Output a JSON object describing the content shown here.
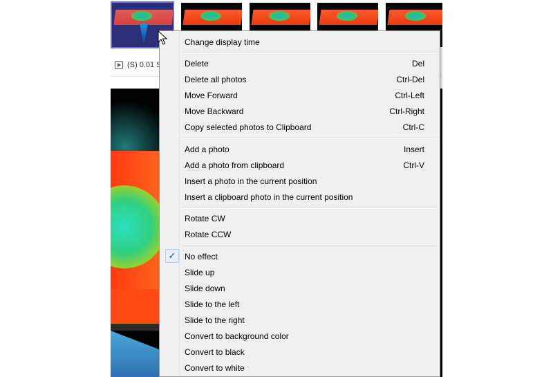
{
  "status": {
    "duration_text": "(S) 0.01 S"
  },
  "menu": {
    "items": [
      {
        "label": "Change display time",
        "shortcut": ""
      },
      {
        "label": "Delete",
        "shortcut": "Del"
      },
      {
        "label": "Delete all photos",
        "shortcut": "Ctrl-Del"
      },
      {
        "label": "Move Forward",
        "shortcut": "Ctrl-Left"
      },
      {
        "label": "Move Backward",
        "shortcut": "Ctrl-Right"
      },
      {
        "label": "Copy selected photos to Clipboard",
        "shortcut": "Ctrl-C"
      },
      {
        "label": "Add a photo",
        "shortcut": "Insert"
      },
      {
        "label": "Add a photo from clipboard",
        "shortcut": "Ctrl-V"
      },
      {
        "label": "Insert a photo in the current position",
        "shortcut": ""
      },
      {
        "label": "Insert a clipboard photo in the current position",
        "shortcut": ""
      },
      {
        "label": "Rotate CW",
        "shortcut": ""
      },
      {
        "label": "Rotate CCW",
        "shortcut": ""
      },
      {
        "label": "No effect",
        "shortcut": "",
        "checked": true
      },
      {
        "label": "Slide up",
        "shortcut": ""
      },
      {
        "label": "Slide down",
        "shortcut": ""
      },
      {
        "label": "Slide to the left",
        "shortcut": ""
      },
      {
        "label": "Slide to the right",
        "shortcut": ""
      },
      {
        "label": "Convert to background color",
        "shortcut": ""
      },
      {
        "label": "Convert to black",
        "shortcut": ""
      },
      {
        "label": "Convert to white",
        "shortcut": ""
      }
    ],
    "check_mark": "✓"
  },
  "icons": {
    "play": "play-icon",
    "cursor": "mouse-pointer-icon",
    "check": "checkmark-icon"
  },
  "colors": {
    "menu_background": "#f0f0f0",
    "menu_border": "#979797",
    "check_color": "#1d4fa0"
  }
}
